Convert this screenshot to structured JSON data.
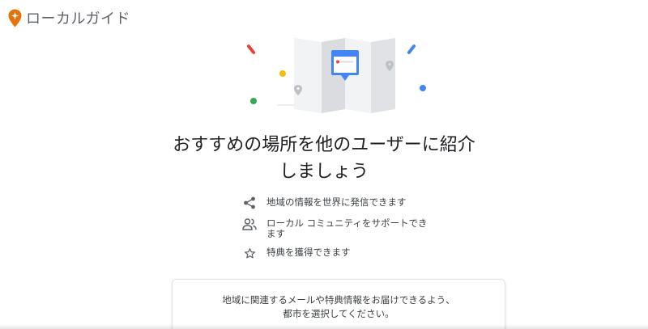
{
  "brand": {
    "name": "ローカルガイド",
    "logo_icon": "local-guides-pin-icon",
    "logo_color": "#e8710a"
  },
  "hero": {
    "illustration": "folded-map-illustration",
    "accent_colors": [
      "#ea4335",
      "#4285f4",
      "#fbbc04",
      "#34a853"
    ]
  },
  "headline": {
    "line1": "おすすめの場所を他のユーザーに紹介",
    "line2": "しましょう"
  },
  "features": [
    {
      "icon": "share-icon",
      "text": "地域の情報を世界に発信できます"
    },
    {
      "icon": "community-icon",
      "text": "ローカル コミュニティをサポートできます"
    },
    {
      "icon": "star-icon",
      "text": "特典を獲得できます"
    }
  ],
  "signup_card": {
    "message": "地域に関連するメールや特典情報をお届けできるよう、都市を選択してください。"
  }
}
